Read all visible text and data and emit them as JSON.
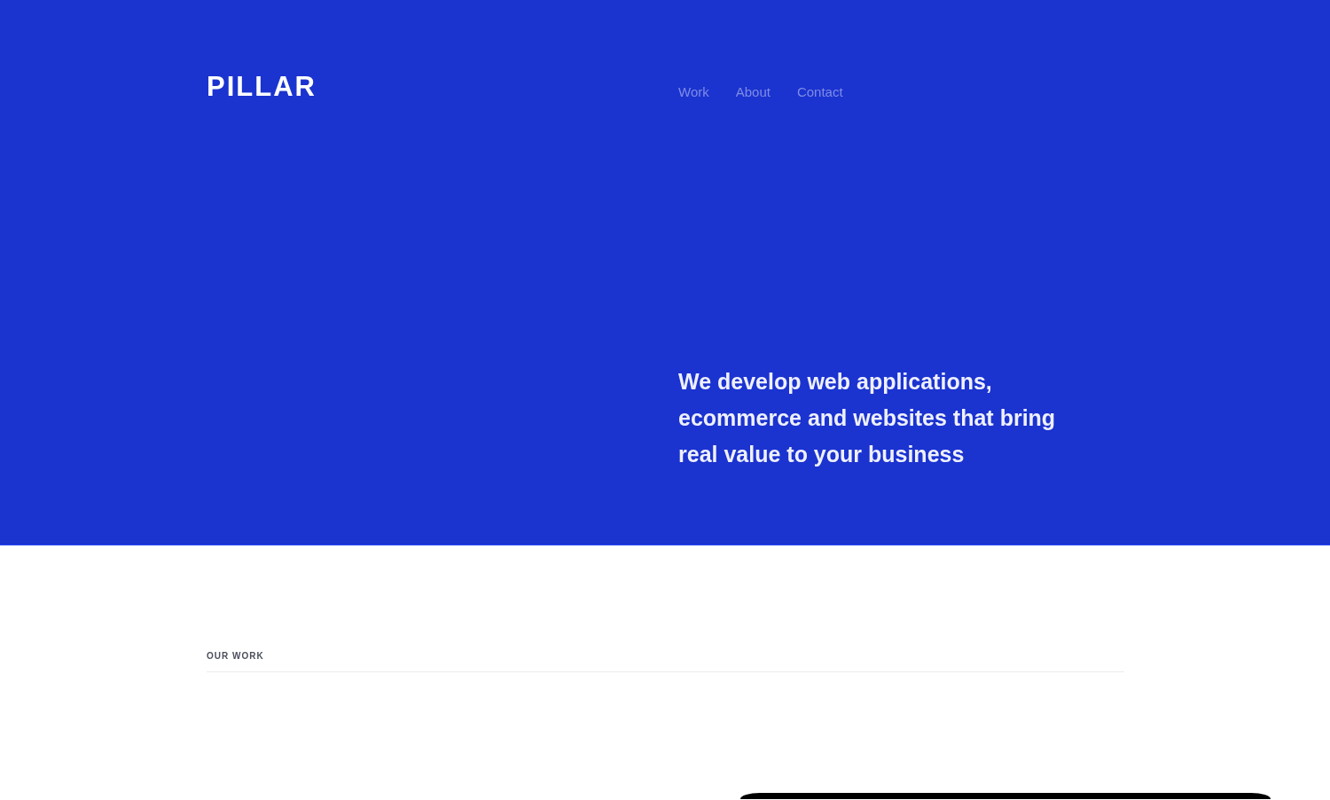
{
  "header": {
    "logo": "PILLAR",
    "nav": [
      {
        "label": "Work"
      },
      {
        "label": "About"
      },
      {
        "label": "Contact"
      }
    ]
  },
  "hero": {
    "tagline": "We develop web applications, ecommerce and websites that bring real value to your business"
  },
  "work_section": {
    "heading": "OUR WORK"
  }
}
